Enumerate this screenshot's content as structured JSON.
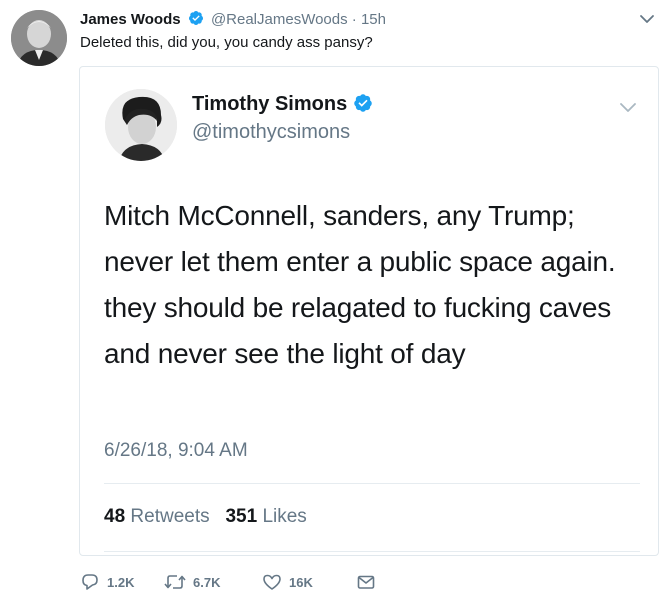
{
  "tweet": {
    "author_name": "James Woods",
    "handle": "@RealJamesWoods",
    "separator": "·",
    "time": "15h",
    "text": "Deleted this, did you, you candy ass pansy?"
  },
  "quoted": {
    "author_name": "Timothy Simons",
    "handle": "@timothycsimons",
    "text": "Mitch McConnell, sanders, any Trump; never let them enter a public space again. they should be relagated to fucking caves and never see the light of day",
    "date": "6/26/18, 9:04 AM",
    "retweets_count": "48",
    "retweets_label": "Retweets",
    "likes_count": "351",
    "likes_label": "Likes"
  },
  "actions": {
    "reply_count": "1.2K",
    "retweet_count": "6.7K",
    "like_count": "16K"
  },
  "colors": {
    "verified": "#1da1f2",
    "secondary_text": "#657786",
    "border": "#e1e8ed"
  },
  "icons": [
    "verified-badge-icon",
    "chevron-down-icon",
    "reply-icon",
    "retweet-icon",
    "like-icon",
    "direct-message-icon"
  ]
}
